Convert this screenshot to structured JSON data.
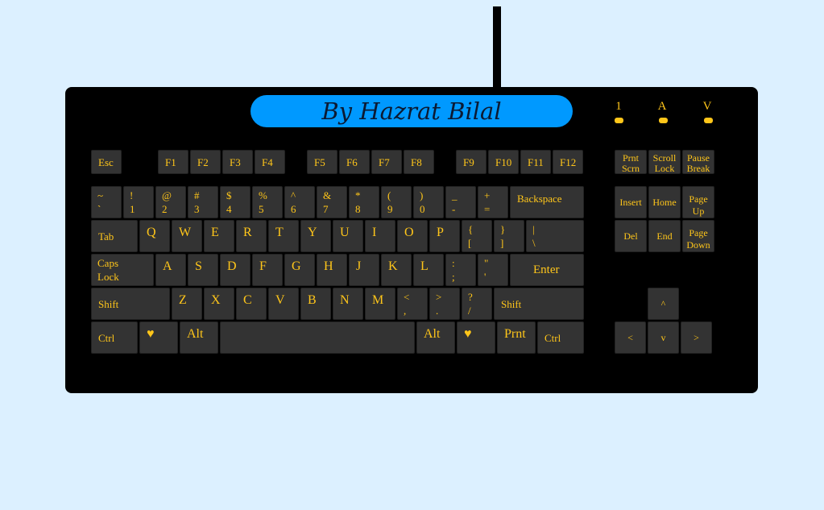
{
  "banner": {
    "title": "By Hazrat Bilal"
  },
  "indicators": [
    "1",
    "A",
    "V"
  ],
  "keys": [
    {
      "id": "esc",
      "lines": [
        "Esc"
      ]
    },
    {
      "id": "f1",
      "lines": [
        "F1"
      ]
    },
    {
      "id": "f2",
      "lines": [
        "F2"
      ]
    },
    {
      "id": "f3",
      "lines": [
        "F3"
      ]
    },
    {
      "id": "f4",
      "lines": [
        "F4"
      ]
    },
    {
      "id": "f5",
      "lines": [
        "F5"
      ]
    },
    {
      "id": "f6",
      "lines": [
        "F6"
      ]
    },
    {
      "id": "f7",
      "lines": [
        "F7"
      ]
    },
    {
      "id": "f8",
      "lines": [
        "F8"
      ]
    },
    {
      "id": "f9",
      "lines": [
        "F9"
      ]
    },
    {
      "id": "f10",
      "lines": [
        "F10"
      ]
    },
    {
      "id": "f11",
      "lines": [
        "F11"
      ]
    },
    {
      "id": "f12",
      "lines": [
        "F12"
      ]
    },
    {
      "id": "prnt-scrn",
      "lines": [
        "Prnt",
        "Scrn"
      ]
    },
    {
      "id": "scroll-lock",
      "lines": [
        "Scroll",
        "Lock"
      ]
    },
    {
      "id": "pause-break",
      "lines": [
        "Pause",
        "Break"
      ]
    },
    {
      "id": "tilde",
      "lines": [
        "~",
        "`"
      ]
    },
    {
      "id": "1",
      "lines": [
        "!",
        "1"
      ]
    },
    {
      "id": "2",
      "lines": [
        "@",
        "2"
      ]
    },
    {
      "id": "3",
      "lines": [
        "#",
        "3"
      ]
    },
    {
      "id": "4",
      "lines": [
        "$",
        "4"
      ]
    },
    {
      "id": "5",
      "lines": [
        "%",
        "5"
      ]
    },
    {
      "id": "6",
      "lines": [
        "^",
        "6"
      ]
    },
    {
      "id": "7",
      "lines": [
        "&",
        "7"
      ]
    },
    {
      "id": "8",
      "lines": [
        "*",
        "8"
      ]
    },
    {
      "id": "9",
      "lines": [
        "(",
        "9"
      ]
    },
    {
      "id": "0",
      "lines": [
        ")",
        "0"
      ]
    },
    {
      "id": "minus",
      "lines": [
        "_",
        "-"
      ]
    },
    {
      "id": "equals",
      "lines": [
        "+",
        "="
      ]
    },
    {
      "id": "backspace",
      "lines": [
        "Backspace"
      ]
    },
    {
      "id": "tab",
      "lines": [
        "Tab"
      ]
    },
    {
      "id": "q",
      "lines": [
        "Q"
      ]
    },
    {
      "id": "w",
      "lines": [
        "W"
      ]
    },
    {
      "id": "e",
      "lines": [
        "E"
      ]
    },
    {
      "id": "r",
      "lines": [
        "R"
      ]
    },
    {
      "id": "t",
      "lines": [
        "T"
      ]
    },
    {
      "id": "y",
      "lines": [
        "Y"
      ]
    },
    {
      "id": "u",
      "lines": [
        "U"
      ]
    },
    {
      "id": "i",
      "lines": [
        "I"
      ]
    },
    {
      "id": "o",
      "lines": [
        "O"
      ]
    },
    {
      "id": "p",
      "lines": [
        "P"
      ]
    },
    {
      "id": "lbracket",
      "lines": [
        "{",
        "["
      ]
    },
    {
      "id": "rbracket",
      "lines": [
        "}",
        "]"
      ]
    },
    {
      "id": "backslash",
      "lines": [
        "|",
        "\\"
      ]
    },
    {
      "id": "caps-lock",
      "lines": [
        "Caps",
        "Lock"
      ]
    },
    {
      "id": "a",
      "lines": [
        "A"
      ]
    },
    {
      "id": "s",
      "lines": [
        "S"
      ]
    },
    {
      "id": "d",
      "lines": [
        "D"
      ]
    },
    {
      "id": "f",
      "lines": [
        "F"
      ]
    },
    {
      "id": "g",
      "lines": [
        "G"
      ]
    },
    {
      "id": "h",
      "lines": [
        "H"
      ]
    },
    {
      "id": "j",
      "lines": [
        "J"
      ]
    },
    {
      "id": "k",
      "lines": [
        "K"
      ]
    },
    {
      "id": "l",
      "lines": [
        "L"
      ]
    },
    {
      "id": "semicolon",
      "lines": [
        ":",
        ";"
      ]
    },
    {
      "id": "quote",
      "lines": [
        "\"",
        "'"
      ]
    },
    {
      "id": "enter",
      "lines": [
        "Enter"
      ]
    },
    {
      "id": "shift-left",
      "lines": [
        "Shift"
      ]
    },
    {
      "id": "z",
      "lines": [
        "Z"
      ]
    },
    {
      "id": "x",
      "lines": [
        "X"
      ]
    },
    {
      "id": "c",
      "lines": [
        "C"
      ]
    },
    {
      "id": "v",
      "lines": [
        "V"
      ]
    },
    {
      "id": "b",
      "lines": [
        "B"
      ]
    },
    {
      "id": "n",
      "lines": [
        "N"
      ]
    },
    {
      "id": "m",
      "lines": [
        "M"
      ]
    },
    {
      "id": "comma",
      "lines": [
        "<",
        ","
      ]
    },
    {
      "id": "period",
      "lines": [
        ">",
        "."
      ]
    },
    {
      "id": "slash",
      "lines": [
        "?",
        "/"
      ]
    },
    {
      "id": "shift-right",
      "lines": [
        "Shift"
      ]
    },
    {
      "id": "ctrl-left",
      "lines": [
        "Ctrl"
      ]
    },
    {
      "id": "heart-left",
      "lines": [
        "♥"
      ]
    },
    {
      "id": "alt-left",
      "lines": [
        "Alt"
      ]
    },
    {
      "id": "space",
      "lines": [
        ""
      ]
    },
    {
      "id": "alt-right",
      "lines": [
        "Alt"
      ]
    },
    {
      "id": "heart-right",
      "lines": [
        "♥"
      ]
    },
    {
      "id": "prnt",
      "lines": [
        "Prnt"
      ]
    },
    {
      "id": "ctrl-right",
      "lines": [
        "Ctrl"
      ]
    },
    {
      "id": "insert",
      "lines": [
        "Insert"
      ]
    },
    {
      "id": "home",
      "lines": [
        "Home"
      ]
    },
    {
      "id": "page-up",
      "lines": [
        "Page",
        "Up"
      ]
    },
    {
      "id": "del",
      "lines": [
        "Del"
      ]
    },
    {
      "id": "end",
      "lines": [
        "End"
      ]
    },
    {
      "id": "page-down",
      "lines": [
        "Page",
        "Down"
      ]
    },
    {
      "id": "arrow-up",
      "lines": [
        "^"
      ]
    },
    {
      "id": "arrow-left",
      "lines": [
        "<"
      ]
    },
    {
      "id": "arrow-down",
      "lines": [
        "v"
      ]
    },
    {
      "id": "arrow-right",
      "lines": [
        ">"
      ]
    }
  ]
}
